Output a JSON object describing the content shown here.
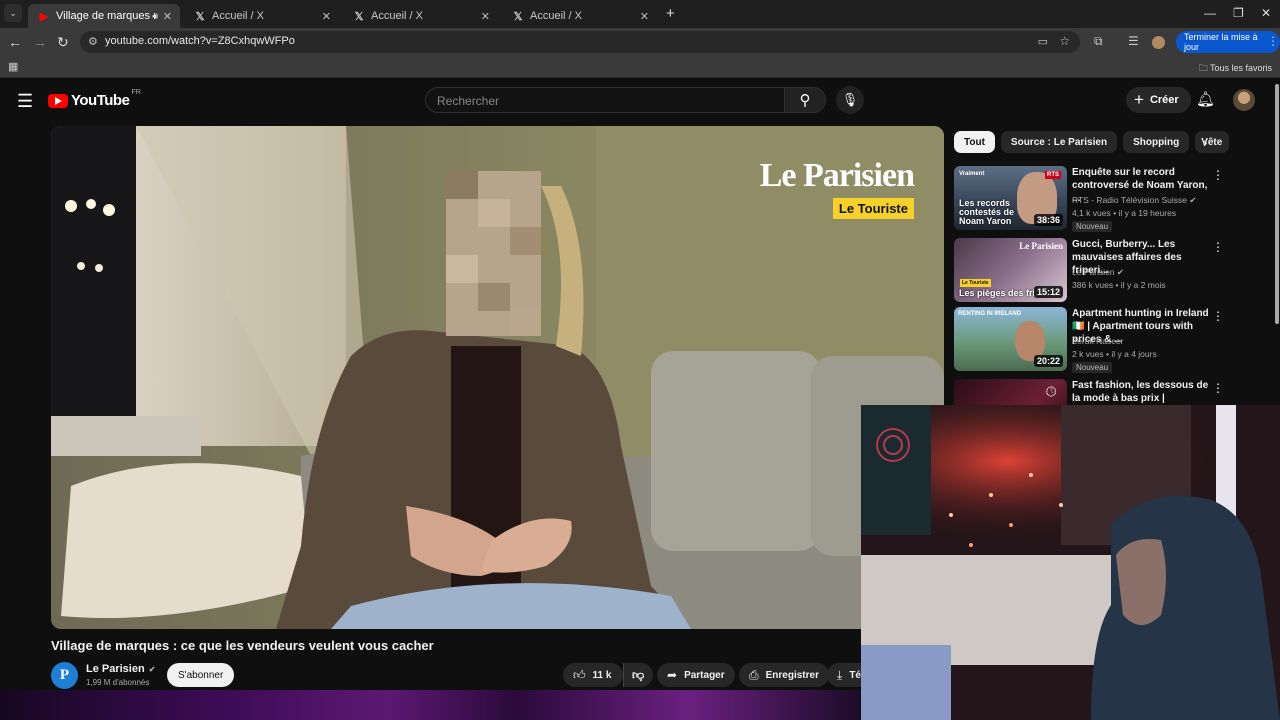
{
  "browser": {
    "tabs": [
      {
        "label": "Village de marques : ce que",
        "active": true
      },
      {
        "label": "Accueil / X"
      },
      {
        "label": "Accueil / X"
      },
      {
        "label": "Accueil / X"
      }
    ],
    "url": "youtube.com/watch?v=Z8CxhqwWFPo",
    "update_button": "Terminer la mise à jour",
    "all_bookmarks": "Tous les favoris"
  },
  "youtube": {
    "country": "FR",
    "logo_text": "YouTube",
    "search_placeholder": "Rechercher",
    "create_label": "Créer"
  },
  "video": {
    "title": "Village de marques : ce que les vendeurs veulent vous cacher",
    "brand_name": "Le Parisien",
    "brand_tag": "Le Touriste",
    "channel": "Le Parisien",
    "subscribers": "1,99 M d'abonnés",
    "subscribe_label": "S'abonner",
    "likes": "11 k",
    "share_label": "Partager",
    "save_label": "Enregistrer",
    "download_label": "Té"
  },
  "chips": [
    "Tout",
    "Source : Le Parisien",
    "Shopping",
    "Vête"
  ],
  "recommendations": [
    {
      "title": "Enquête sur le record controversé de Noam Yaron, ...",
      "channel": "RTS - Radio Télévision Suisse",
      "meta": "4,1 k vues • il y a 19 heures",
      "badge": "Nouveau",
      "duration": "38:36",
      "thumb_text": "Les records contestés de Noam Yaron",
      "thumb_tag": "Vraiment",
      "thumb_logo": "RTS"
    },
    {
      "title": "Gucci, Burberry... Les mauvaises affaires des friperi...",
      "channel": "Le Parisien",
      "meta": "386 k vues • il y a 2 mois",
      "duration": "15:12",
      "thumb_text": "Les pièges des friperies",
      "thumb_logo": "Le Parisien",
      "thumb_tag": "Le Touriste"
    },
    {
      "title": "Apartment hunting in Ireland 🇮🇪 | Apartment tours with prices & ...",
      "channel": "Zerak Naseer",
      "meta": "2 k vues • il y a 4 jours",
      "badge": "Nouveau",
      "duration": "20:22",
      "thumb_tag": "RENTING IN IRELAND"
    },
    {
      "title": "Fast fashion, les dessous de la mode à bas prix | Documentair..."
    }
  ]
}
